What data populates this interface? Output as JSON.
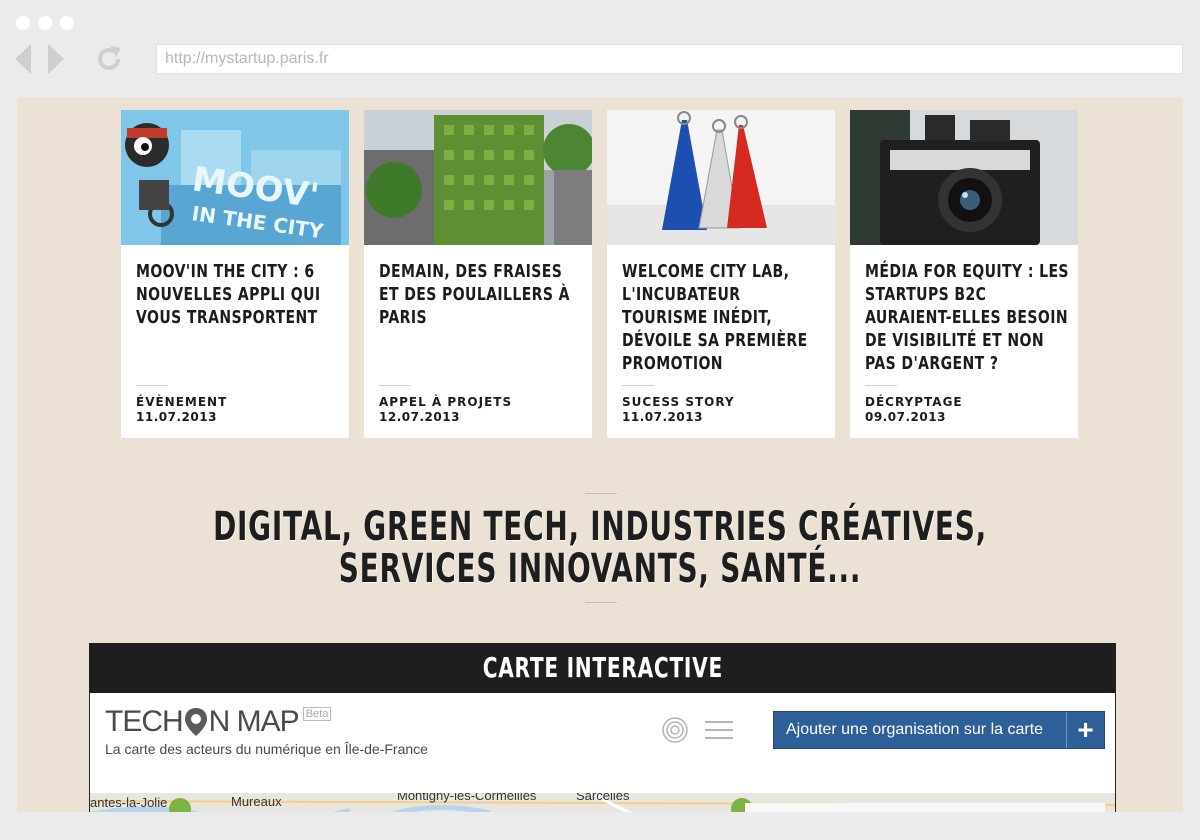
{
  "browser": {
    "url": "http://mystartup.paris.fr"
  },
  "articles": [
    {
      "title": "MOOV'IN THE CITY : 6 NOUVELLES APPLI QUI VOUS TRANSPORTENT",
      "category": "ÉVÈNEMENT",
      "date": "11.07.2013",
      "image": "moovin-the-city-illustration"
    },
    {
      "title": "DEMAIN, DES FRAISES ET DES POULAILLERS À PARIS",
      "category": "APPEL À PROJETS",
      "date": "12.07.2013",
      "image": "green-building-photo"
    },
    {
      "title": "WELCOME CITY LAB, L'INCUBATEUR TOURISME INÉDIT, DÉVOILE SA PREMIÈRE PROMOTION",
      "category": "SUCESS STORY",
      "date": "11.07.2013",
      "image": "eiffel-tower-keychains-photo"
    },
    {
      "title": "MÉDIA FOR EQUITY : LES STARTUPS B2C AURAIENT-ELLES BESOIN DE VISIBILITÉ ET NON PAS D'ARGENT ?",
      "category": "DÉCRYPTAGE",
      "date": "09.07.2013",
      "image": "camera-photo"
    }
  ],
  "tagline": {
    "line1": "DIGITAL, GREEN TECH, INDUSTRIES CRÉATIVES,",
    "line2": "SERVICES INNOVANTS, SANTÉ..."
  },
  "map": {
    "header": "CARTE INTERACTIVE",
    "logo_part1": "TECH ",
    "logo_part2": "N MAP",
    "beta": "Beta",
    "subtitle": "La carte des acteurs du numérique en Île-de-France",
    "add_button": "Ajouter une organisation sur la carte",
    "add_plus": "+",
    "places": [
      "antes-la-Jolie",
      "Mureaux",
      "Montigny-lès-Cormeilles",
      "Sarcelles"
    ]
  },
  "colors": {
    "page_bg": "#ebe1d5",
    "button_blue": "#2f5f98",
    "header_dark": "#1e1e1e"
  }
}
